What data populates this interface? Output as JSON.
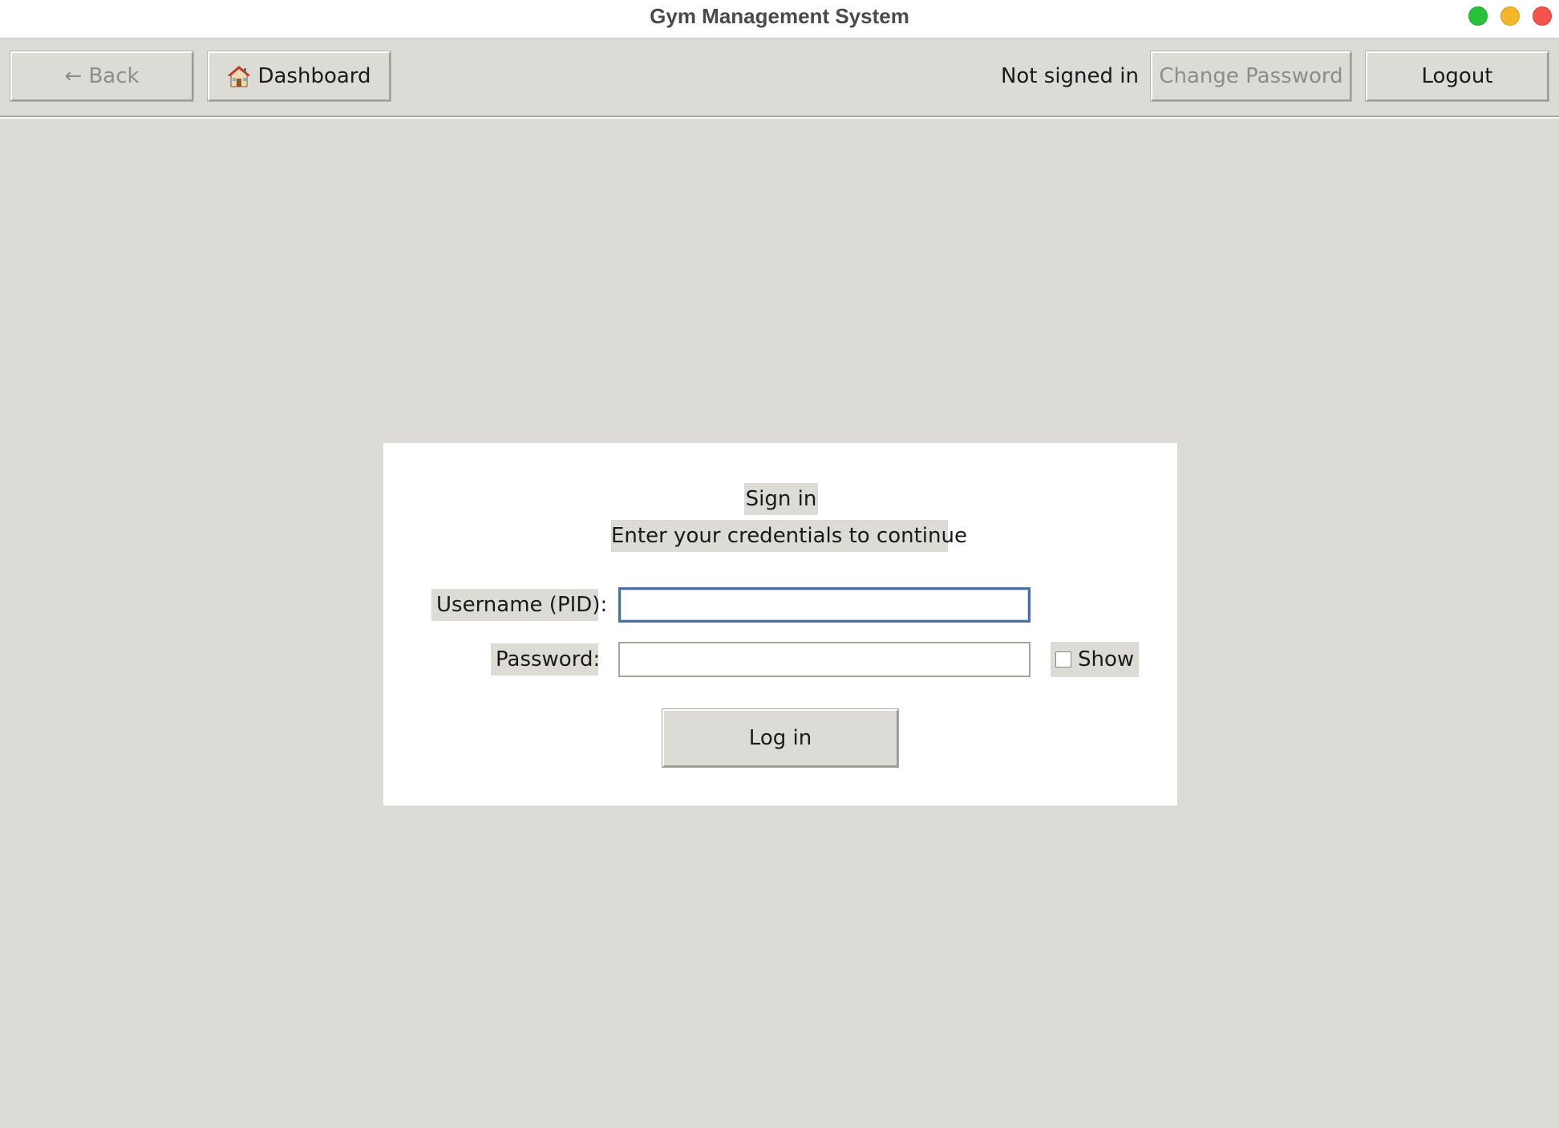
{
  "window": {
    "title": "Gym Management System",
    "controls": [
      "green",
      "yellow",
      "red"
    ]
  },
  "toolbar": {
    "back_label": "← Back",
    "dashboard_label": "Dashboard",
    "dashboard_icon": "house-icon",
    "status": "Not signed in",
    "change_password_label": "Change Password",
    "logout_label": "Logout"
  },
  "login": {
    "heading": "Sign in",
    "subheading": "Enter your credentials to continue",
    "username_label": "Username (PID):",
    "username_value": "",
    "password_label": "Password:",
    "password_value": "",
    "show_label": "Show",
    "show_checked": false,
    "submit_label": "Log in"
  },
  "colors": {
    "background": "#dcdbd6",
    "card": "#ffffff",
    "focus_border": "#4a6fa0",
    "disabled_text": "#8d8c88"
  }
}
